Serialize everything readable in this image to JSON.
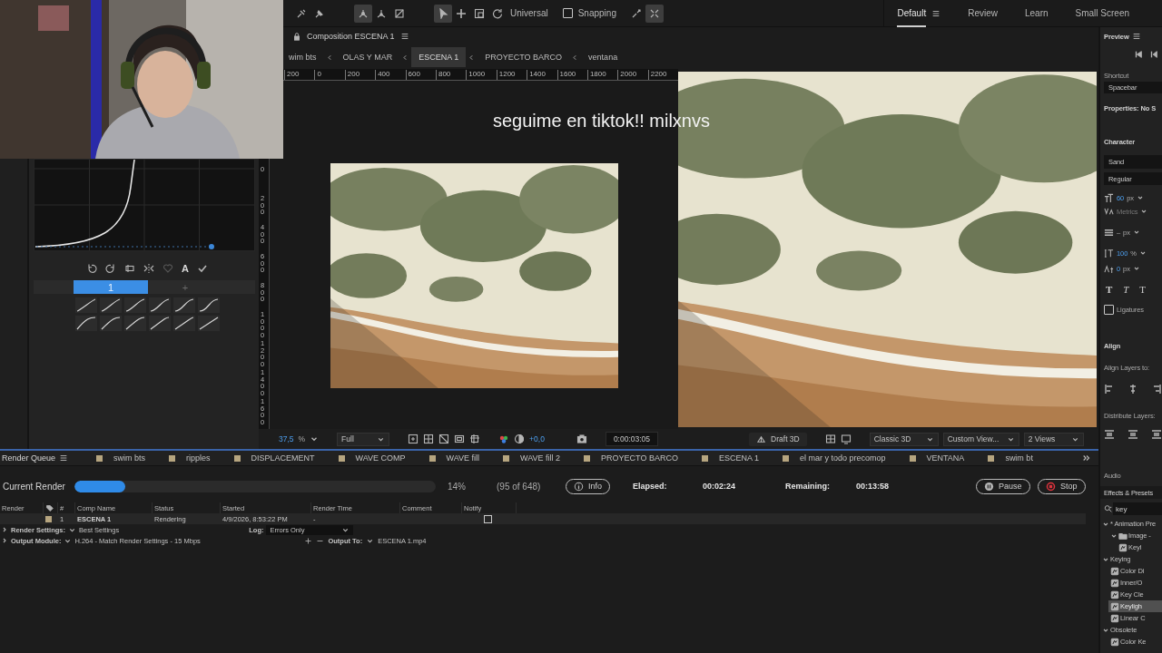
{
  "toolbar": {
    "tools": [
      {
        "kind": "brush",
        "selected": false
      },
      {
        "kind": "pin",
        "selected": false
      },
      {
        "kind": "axis-local",
        "selected": true
      },
      {
        "kind": "axis-world",
        "selected": false
      },
      {
        "kind": "axis-view",
        "selected": false
      },
      {
        "kind": "select",
        "selected": true
      },
      {
        "kind": "move",
        "selected": false
      },
      {
        "kind": "box",
        "selected": false
      },
      {
        "kind": "rotate",
        "selected": false
      }
    ],
    "axis_mode": "Universal",
    "snapping": {
      "label": "Snapping",
      "checked": false
    },
    "extra_tools": [
      {
        "kind": "snap-tool",
        "selected": false
      },
      {
        "kind": "expand",
        "selected": true
      }
    ]
  },
  "workspaces": [
    {
      "label": "Default",
      "selected": true
    },
    {
      "label": "Review",
      "selected": false
    },
    {
      "label": "Learn",
      "selected": false
    },
    {
      "label": "Small Screen",
      "selected": false
    }
  ],
  "ease_panel": {
    "auto_label": "A",
    "tabs": [
      {
        "label": "1",
        "selected": true
      },
      {
        "label": "+",
        "selected": false
      }
    ]
  },
  "composition": {
    "title": "Composition ESCENA 1",
    "breadcrumbs": [
      {
        "label": "wim bts",
        "selected": false
      },
      {
        "label": "OLAS Y MAR",
        "selected": false
      },
      {
        "label": "ESCENA 1",
        "selected": true
      },
      {
        "label": "PROYECTO BARCO",
        "selected": false
      },
      {
        "label": "ventana",
        "selected": false
      }
    ],
    "ruler_labels": [
      "200",
      "0",
      "200",
      "400",
      "600",
      "800",
      "1000",
      "1200",
      "1400",
      "1600",
      "1800",
      "2000",
      "2200"
    ],
    "vertical_ruler_labels": [
      "0",
      "200",
      "400",
      "600",
      "800",
      "1000",
      "1200",
      "1400",
      "1600"
    ],
    "caption": "seguime en tiktok!! milxnvs",
    "footer": {
      "zoom": "37,5",
      "zoom_unit": "%",
      "resolution": "Full",
      "exposure": "+0,0",
      "timecode": "0:00:03:05",
      "renderer": "Draft 3D",
      "renderer_mode": "Classic 3D",
      "view": "Custom View...",
      "layout": "2 Views"
    }
  },
  "render_queue": {
    "title": "Render Queue",
    "tabs": [
      "swim bts",
      "ripples",
      "DISPLACEMENT",
      "WAVE COMP",
      "WAVE fill",
      "WAVE fill 2",
      "PROYECTO BARCO",
      "ESCENA 1",
      "el mar y todo precomop",
      "VENTANA",
      "swim bt"
    ],
    "current_render": {
      "label": "Current Render",
      "level": 0.14,
      "percent": "14%",
      "frames": "(95 of 648)",
      "info": "Info",
      "elapsed_label": "Elapsed:",
      "elapsed": "00:02:24",
      "remaining_label": "Remaining:",
      "remaining": "00:13:58",
      "buttons": [
        {
          "kind": "pause",
          "label": "Pause"
        },
        {
          "kind": "stop",
          "label": "Stop"
        }
      ]
    },
    "columns": [
      "Render",
      "#",
      "Comp Name",
      "Status",
      "Started",
      "Render Time",
      "Comment",
      "Notify"
    ],
    "rows": [
      {
        "number": "1",
        "comp": "ESCENA 1",
        "status": "Rendering",
        "started": "4/9/2026, 8:53:22 PM",
        "render_time": "-",
        "notify": false
      }
    ],
    "render_settings": {
      "label": "Render Settings:",
      "value": "Best Settings"
    },
    "log": {
      "label": "Log:",
      "value": "Errors Only"
    },
    "output_module": {
      "label": "Output Module:",
      "value": "H.264 - Match Render Settings - 15 Mbps"
    },
    "output_to": {
      "label": "Output To:",
      "value": "ESCENA 1.mp4"
    }
  },
  "preview": {
    "title": "Preview",
    "shortcut_label": "Shortcut",
    "shortcut": "Spacebar"
  },
  "properties": {
    "title": "Properties: No S"
  },
  "character": {
    "title": "Character",
    "font": "Sand",
    "style": "Regular",
    "size": "60",
    "size_unit": "px",
    "kerning": "Metrics",
    "leading": "–",
    "leading_unit": "px",
    "scale": "100",
    "scale_unit": "%",
    "baseline": "0",
    "baseline_unit": "px",
    "text_styles": [
      {
        "label": "T",
        "kind": "bold"
      },
      {
        "label": "T",
        "kind": "italic"
      },
      {
        "label": "T",
        "kind": "caps"
      }
    ],
    "ligatures": {
      "label": "Ligatures",
      "checked": false
    }
  },
  "align": {
    "title": "Align",
    "align_to": "Align Layers to:",
    "distribute": "Distribute Layers:"
  },
  "audio": {
    "title": "Audio"
  },
  "effects": {
    "title": "Effects & Presets",
    "search": "key",
    "tree": [
      {
        "label": "* Animation Pre",
        "expanded": true,
        "children": [
          {
            "label": "Image -",
            "kind": "folder",
            "expanded": true,
            "children": [
              {
                "label": "Keyl",
                "kind": "effect",
                "selected": false
              }
            ]
          }
        ]
      },
      {
        "label": "Keying",
        "expanded": true,
        "children": [
          {
            "label": "Color Di",
            "kind": "effect",
            "selected": false
          },
          {
            "label": "Inner/O",
            "kind": "effect",
            "selected": false
          },
          {
            "label": "Key Cle",
            "kind": "effect",
            "selected": false
          },
          {
            "label": "Keyligh",
            "kind": "effect",
            "selected": true
          },
          {
            "label": "Linear C",
            "kind": "effect",
            "selected": false
          }
        ]
      },
      {
        "label": "Obsolete",
        "expanded": true,
        "children": [
          {
            "label": "Color Ke",
            "kind": "effect",
            "selected": false
          }
        ]
      }
    ]
  }
}
